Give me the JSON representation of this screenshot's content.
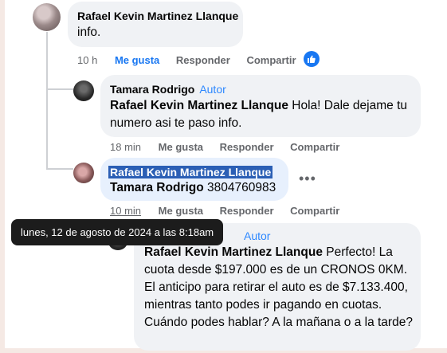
{
  "comments": [
    {
      "author": "Rafael Kevin Martinez Llanque",
      "text": "info.",
      "time": "10 h",
      "actions": [
        "Me gusta",
        "Responder",
        "Compartir"
      ]
    },
    {
      "author": "Tamara Rodrigo",
      "badge": "Autor",
      "mention": "Rafael Kevin Martinez Llanque",
      "text": " Hola! Dale dejame tu numero asi te paso info.",
      "time": "18 min",
      "actions": [
        "Me gusta",
        "Responder",
        "Compartir"
      ]
    },
    {
      "selected_text": "Rafael Kevin Martinez Llanque",
      "mention": "Tamara Rodrigo",
      "text": " 3804760983",
      "time": "10 min",
      "actions": [
        "Me gusta",
        "Responder",
        "Compartir"
      ]
    },
    {
      "badge": "Autor",
      "mention": "Rafael Kevin Martinez Llanque",
      "text": " Perfecto! La cuota desde $197.000 es de un CRONOS 0KM. El anticipo para retirar el auto es de $7.133.400, mientras tanto podes ir pagando en cuotas. Cuándo podes hablar? A la mañana o a la tarde?"
    }
  ],
  "tooltip": "lunes, 12 de agosto de 2024 a las 8:18am",
  "colors": {
    "like": "#1877f2",
    "author_badge": "#2d88ff",
    "bubble": "#f0f2f5",
    "selection": "#2b5fb5"
  }
}
